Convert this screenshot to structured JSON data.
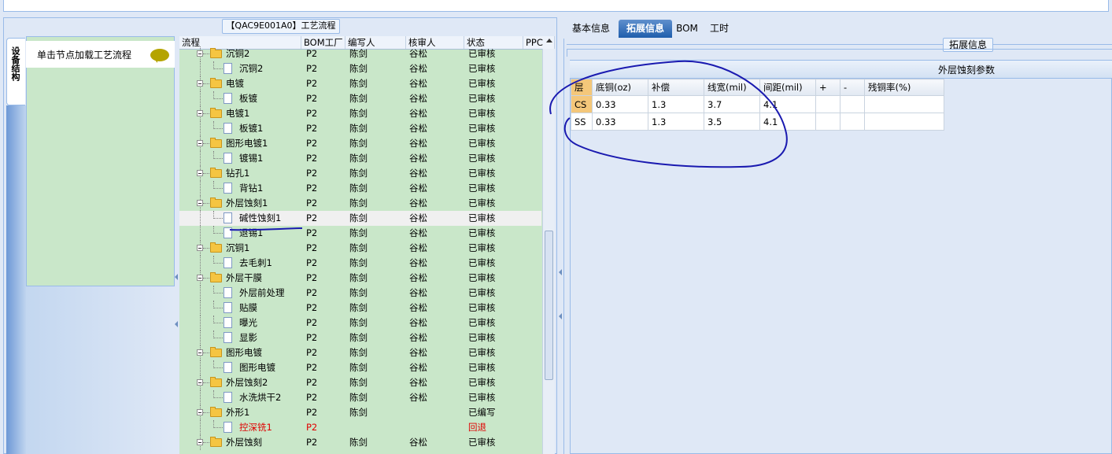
{
  "left_panel": {
    "title": "【QAC9E001A0】工艺流程",
    "vertical_tab": "设备结构",
    "node_hint": "单击节点加载工艺流程"
  },
  "grid": {
    "columns": [
      "流程",
      "BOM工厂",
      "编写人",
      "核审人",
      "状态",
      "PPC"
    ],
    "rows": [
      {
        "name": "沉铜2",
        "level": 0,
        "bom": "P2",
        "writer": "陈剑",
        "reviewer": "谷松",
        "status": "已审核"
      },
      {
        "name": "沉铜2",
        "level": 1,
        "bom": "P2",
        "writer": "陈剑",
        "reviewer": "谷松",
        "status": "已审核"
      },
      {
        "name": "电镀",
        "level": 0,
        "bom": "P2",
        "writer": "陈剑",
        "reviewer": "谷松",
        "status": "已审核"
      },
      {
        "name": "板镀",
        "level": 1,
        "bom": "P2",
        "writer": "陈剑",
        "reviewer": "谷松",
        "status": "已审核"
      },
      {
        "name": "电镀1",
        "level": 0,
        "bom": "P2",
        "writer": "陈剑",
        "reviewer": "谷松",
        "status": "已审核"
      },
      {
        "name": "板镀1",
        "level": 1,
        "bom": "P2",
        "writer": "陈剑",
        "reviewer": "谷松",
        "status": "已审核"
      },
      {
        "name": "图形电镀1",
        "level": 0,
        "bom": "P2",
        "writer": "陈剑",
        "reviewer": "谷松",
        "status": "已审核"
      },
      {
        "name": "镀锡1",
        "level": 1,
        "bom": "P2",
        "writer": "陈剑",
        "reviewer": "谷松",
        "status": "已审核"
      },
      {
        "name": "钻孔1",
        "level": 0,
        "bom": "P2",
        "writer": "陈剑",
        "reviewer": "谷松",
        "status": "已审核"
      },
      {
        "name": "背钻1",
        "level": 1,
        "bom": "P2",
        "writer": "陈剑",
        "reviewer": "谷松",
        "status": "已审核"
      },
      {
        "name": "外层蚀刻1",
        "level": 0,
        "bom": "P2",
        "writer": "陈剑",
        "reviewer": "谷松",
        "status": "已审核"
      },
      {
        "name": "碱性蚀刻1",
        "level": 1,
        "bom": "P2",
        "writer": "陈剑",
        "reviewer": "谷松",
        "status": "已审核",
        "selected": true
      },
      {
        "name": "退锡1",
        "level": 1,
        "bom": "P2",
        "writer": "陈剑",
        "reviewer": "谷松",
        "status": "已审核"
      },
      {
        "name": "沉铜1",
        "level": 0,
        "bom": "P2",
        "writer": "陈剑",
        "reviewer": "谷松",
        "status": "已审核"
      },
      {
        "name": "去毛刺1",
        "level": 1,
        "bom": "P2",
        "writer": "陈剑",
        "reviewer": "谷松",
        "status": "已审核"
      },
      {
        "name": "外层干膜",
        "level": 0,
        "bom": "P2",
        "writer": "陈剑",
        "reviewer": "谷松",
        "status": "已审核"
      },
      {
        "name": "外层前处理",
        "level": 1,
        "bom": "P2",
        "writer": "陈剑",
        "reviewer": "谷松",
        "status": "已审核"
      },
      {
        "name": "贴膜",
        "level": 1,
        "bom": "P2",
        "writer": "陈剑",
        "reviewer": "谷松",
        "status": "已审核"
      },
      {
        "name": "曝光",
        "level": 1,
        "bom": "P2",
        "writer": "陈剑",
        "reviewer": "谷松",
        "status": "已审核"
      },
      {
        "name": "显影",
        "level": 1,
        "bom": "P2",
        "writer": "陈剑",
        "reviewer": "谷松",
        "status": "已审核"
      },
      {
        "name": "图形电镀",
        "level": 0,
        "bom": "P2",
        "writer": "陈剑",
        "reviewer": "谷松",
        "status": "已审核"
      },
      {
        "name": "图形电镀",
        "level": 1,
        "bom": "P2",
        "writer": "陈剑",
        "reviewer": "谷松",
        "status": "已审核"
      },
      {
        "name": "外层蚀刻2",
        "level": 0,
        "bom": "P2",
        "writer": "陈剑",
        "reviewer": "谷松",
        "status": "已审核"
      },
      {
        "name": "水洗烘干2",
        "level": 1,
        "bom": "P2",
        "writer": "陈剑",
        "reviewer": "谷松",
        "status": "已审核"
      },
      {
        "name": "外形1",
        "level": 0,
        "bom": "P2",
        "writer": "陈剑",
        "reviewer": "",
        "status": "已编写"
      },
      {
        "name": "控深铣1",
        "level": 1,
        "bom": "P2",
        "writer": "",
        "reviewer": "",
        "status": "回退",
        "red": true
      },
      {
        "name": "外层蚀刻",
        "level": 0,
        "bom": "P2",
        "writer": "陈剑",
        "reviewer": "谷松",
        "status": "已审核"
      }
    ]
  },
  "tabs": [
    "基本信息",
    "拓展信息",
    "BOM",
    "工时"
  ],
  "active_tab": 1,
  "extension_title": "拓展信息",
  "etch_section_title": "外层蚀刻参数",
  "params_table": {
    "headers": [
      "层",
      "底铜(oz)",
      "补偿",
      "线宽(mil)",
      "间距(mil)",
      "+",
      "-",
      "残铜率(%)"
    ],
    "rows": [
      [
        "CS",
        "0.33",
        "1.3",
        "3.7",
        "4.1",
        "",
        "",
        ""
      ],
      [
        "SS",
        "0.33",
        "1.3",
        "3.5",
        "4.1",
        "",
        "",
        ""
      ]
    ]
  },
  "colors": {
    "grid_bg": "#c9e7c9",
    "active_tab": "#1f5eac",
    "annotation_ink": "#1a1ab0",
    "reverted_text": "#e00000"
  }
}
